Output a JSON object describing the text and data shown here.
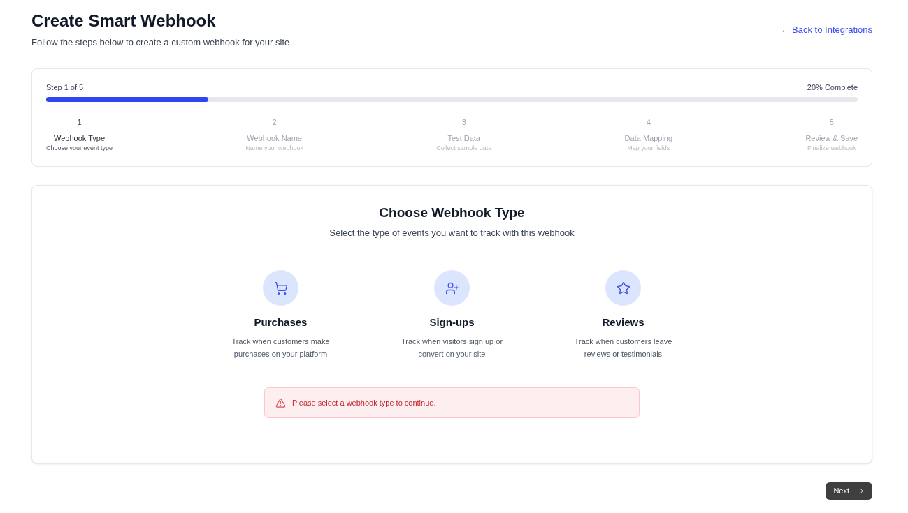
{
  "header": {
    "title": "Create Smart Webhook",
    "subtitle": "Follow the steps below to create a custom webhook for your site",
    "back_link": "← Back to Integrations"
  },
  "progress": {
    "step_label": "Step 1 of 5",
    "percent_label": "20% Complete",
    "level": 0.2,
    "steps": [
      {
        "number": "1",
        "title": "Webhook Type",
        "description": "Choose your event type",
        "current": true
      },
      {
        "number": "2",
        "title": "Webhook Name",
        "description": "Name your webhook",
        "current": false
      },
      {
        "number": "3",
        "title": "Test Data",
        "description": "Collect sample data",
        "current": false
      },
      {
        "number": "4",
        "title": "Data Mapping",
        "description": "Map your fields",
        "current": false
      },
      {
        "number": "5",
        "title": "Review & Save",
        "description": "Finalize webhook",
        "current": false
      }
    ]
  },
  "panel": {
    "title": "Choose Webhook Type",
    "subtitle": "Select the type of events you want to track with this webhook",
    "options": [
      {
        "kind": "cart",
        "title": "Purchases",
        "description": "Track when customers make purchases on your platform",
        "selected": false
      },
      {
        "kind": "user",
        "title": "Sign-ups",
        "description": "Track when visitors sign up or convert on your site",
        "selected": false
      },
      {
        "kind": "star",
        "title": "Reviews",
        "description": "Track when customers leave reviews or testimonials",
        "selected": false
      }
    ],
    "alert": "Please select a webhook type to continue."
  },
  "footer": {
    "next_button": "Next"
  }
}
